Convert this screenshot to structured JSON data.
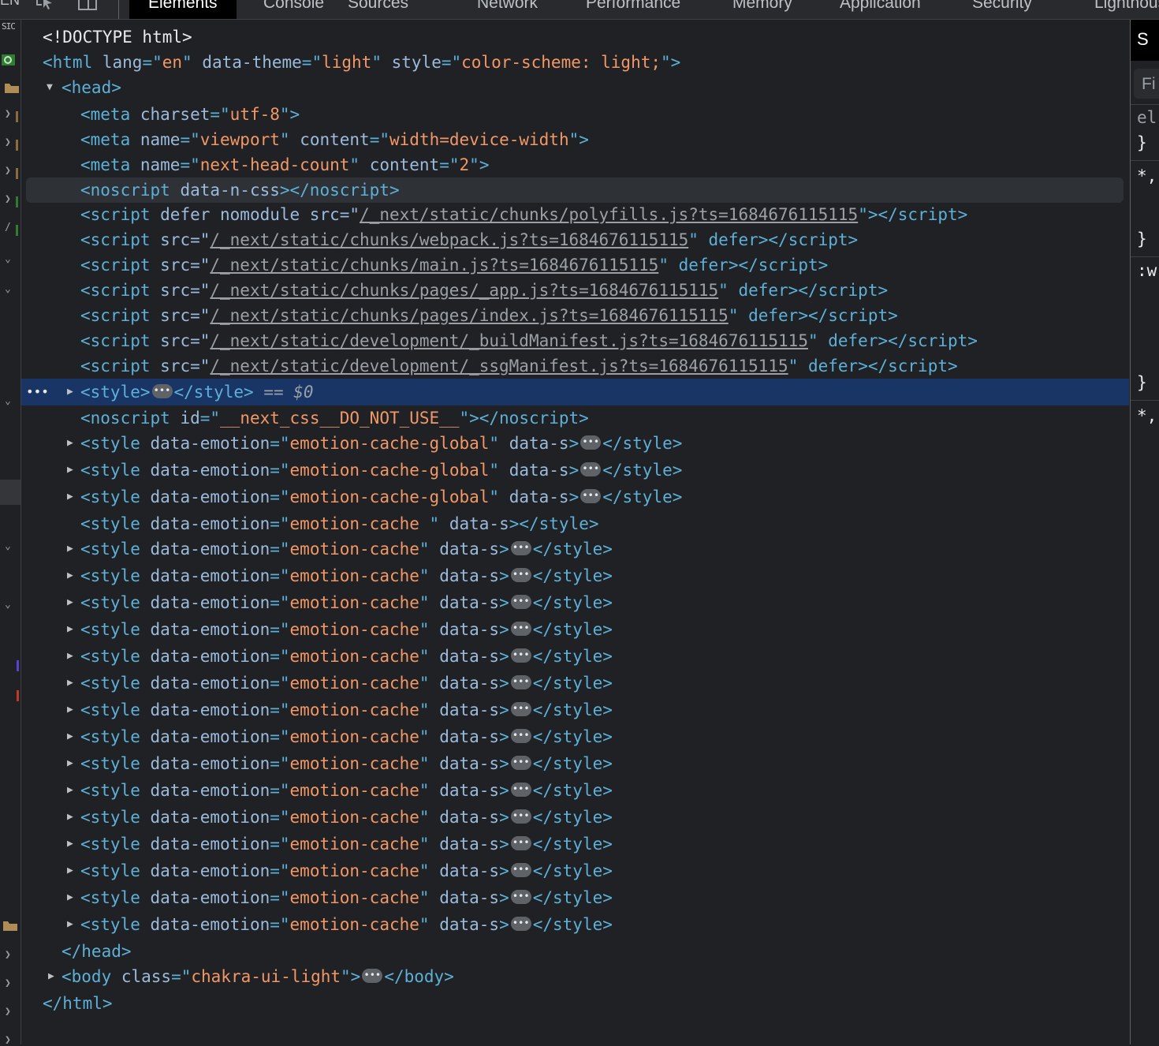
{
  "tabs": [
    "Elements",
    "Console",
    "Sources",
    "Network",
    "Performance",
    "Memory",
    "Application",
    "Security",
    "Lighthouse"
  ],
  "active_tab": "Elements",
  "colors": {
    "background": "#202124",
    "selected": "#193566",
    "tag": "#5db0d7",
    "attr_name": "#9bbbdc",
    "attr_value": "#f29766",
    "link": "#9aa0a6"
  },
  "gutter": {
    "top_label": "SIC",
    "corner_label": "EN"
  },
  "dom": {
    "doctype": "<!DOCTYPE html>",
    "html_open": "<html",
    "html_attrs": [
      {
        "name": "lang",
        "value": "en"
      },
      {
        "name": "data-theme",
        "value": "light"
      },
      {
        "name": "style",
        "value": "color-scheme: light;"
      }
    ],
    "head_open": "<head>",
    "meta_charset": {
      "name": "charset",
      "value": "utf-8"
    },
    "meta_viewport": [
      {
        "name": "name",
        "value": "viewport"
      },
      {
        "name": "content",
        "value": "width=device-width"
      }
    ],
    "meta_headcount": [
      {
        "name": "name",
        "value": "next-head-count"
      },
      {
        "name": "content",
        "value": "2"
      }
    ],
    "noscript_ncss": "data-n-css",
    "scripts": [
      {
        "pre": "defer nomodule src=\"",
        "src": "/_next/static/chunks/polyfills.js?ts=1684676115115",
        "post": "\">"
      },
      {
        "pre": "src=\"",
        "src": "/_next/static/chunks/webpack.js?ts=1684676115115",
        "post": "\" defer>"
      },
      {
        "pre": "src=\"",
        "src": "/_next/static/chunks/main.js?ts=1684676115115",
        "post": "\" defer>"
      },
      {
        "pre": "src=\"",
        "src": "/_next/static/chunks/pages/_app.js?ts=1684676115115",
        "post": "\" defer>"
      },
      {
        "pre": "src=\"",
        "src": "/_next/static/chunks/pages/index.js?ts=1684676115115",
        "post": "\" defer>"
      },
      {
        "pre": "src=\"",
        "src": "/_next/static/development/_buildManifest.js?ts=1684676115115",
        "post": "\" defer>"
      },
      {
        "pre": "src=\"",
        "src": "/_next/static/development/_ssgManifest.js?ts=1684676115115",
        "post": "\" defer>"
      }
    ],
    "selected_style_suffix": "== $0",
    "noscript_next_css": "__next_css__DO_NOT_USE__",
    "emotion_global": "emotion-cache-global",
    "emotion_global_count": 3,
    "emotion_cache_blank": "emotion-cache ",
    "emotion_cache": "emotion-cache",
    "emotion_cache_count": 15,
    "data_s": "data-s",
    "head_close": "</head>",
    "body_class": "chakra-ui-light",
    "html_close": "</html>"
  },
  "styles_panel": {
    "header": "S",
    "filter_placeholder": "Fi",
    "lines": [
      "el",
      "}",
      "*,",
      "}",
      ":w",
      "}",
      "*,"
    ]
  }
}
